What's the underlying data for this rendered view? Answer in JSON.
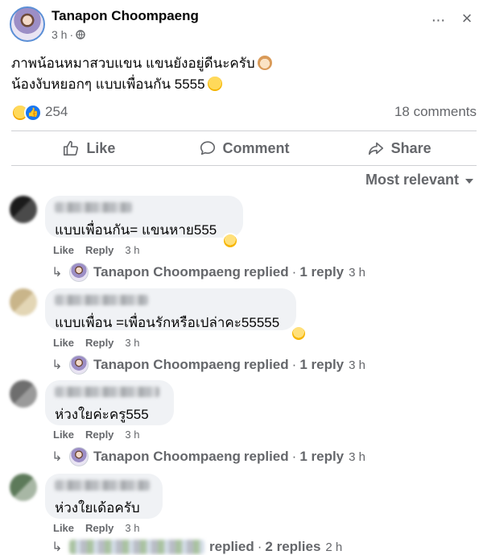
{
  "post": {
    "author": "Tanapon Choompaeng",
    "time": "3 h",
    "dot": "·",
    "text_line1": "ภาพน้อนหมาสวบแขน แขนยังอยู่ดีนะครับ",
    "text_line2": "น้องงับหยอกๆ แบบเพื่อนกัน 5555",
    "reaction_count": "254",
    "comments_count": "18 comments"
  },
  "actions": {
    "like": "Like",
    "comment": "Comment",
    "share": "Share"
  },
  "sort": {
    "selected": "Most relevant"
  },
  "comments": [
    {
      "text": "แบบเพื่อนกัน= แขนหาย555",
      "like": "Like",
      "reply": "Reply",
      "time": "3 h",
      "replied_by": "Tanapon Choompaeng",
      "replied_label": "replied",
      "reply_count": "1 reply",
      "reply_time": "3 h"
    },
    {
      "text": "แบบเพื่อน =เพื่อนรักหรือเปล่าคะ55555",
      "like": "Like",
      "reply": "Reply",
      "time": "3 h",
      "replied_by": "Tanapon Choompaeng",
      "replied_label": "replied",
      "reply_count": "1 reply",
      "reply_time": "3 h"
    },
    {
      "text": "ห่วงใยค่ะครู555",
      "like": "Like",
      "reply": "Reply",
      "time": "3 h",
      "replied_by": "Tanapon Choompaeng",
      "replied_label": "replied",
      "reply_count": "1 reply",
      "reply_time": "3 h"
    },
    {
      "text": "ห่วงใยเด้อครับ",
      "like": "Like",
      "reply": "Reply",
      "time": "3 h",
      "replied_label": "replied",
      "reply_count": "2 replies",
      "reply_time": "2 h"
    }
  ],
  "colors": {
    "text_primary": "#050505",
    "text_secondary": "#65676b",
    "bubble_bg": "#f0f2f5",
    "like_blue": "#1877f2",
    "divider": "#ced0d4"
  }
}
